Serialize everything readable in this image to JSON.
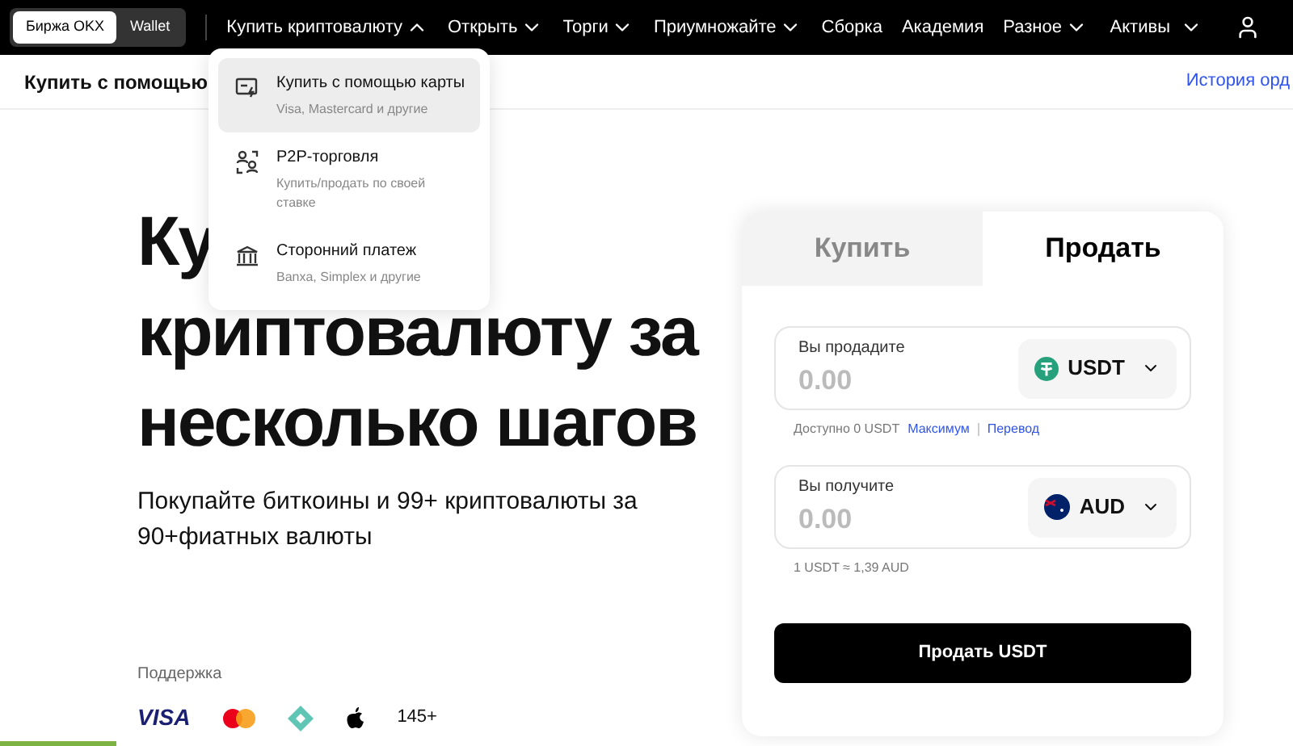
{
  "header": {
    "switch": [
      {
        "label": "Биржа OKX",
        "selected": true
      },
      {
        "label": "Wallet",
        "selected": false
      }
    ],
    "nav": [
      {
        "kind": "menu",
        "label": "Купить криптовалюту",
        "expanded": true
      },
      {
        "kind": "menu",
        "label": "Открыть",
        "expanded": false
      },
      {
        "kind": "menu",
        "label": "Торги",
        "expanded": false
      },
      {
        "kind": "menu",
        "label": "Приумножайте",
        "expanded": false
      },
      {
        "kind": "link",
        "label": "Сборка"
      },
      {
        "kind": "link",
        "label": "Академия"
      },
      {
        "kind": "menu",
        "label": "Разное",
        "expanded": false
      }
    ],
    "assets": "Активы"
  },
  "subbar": {
    "title": "Купить с помощью",
    "link": "История орд"
  },
  "dropdown": [
    {
      "kind": "card",
      "title": "Купить с помощью карты",
      "subtitle": "Visa, Mastercard и другие",
      "selected": true
    },
    {
      "kind": "p2p",
      "title": "P2P-торговля",
      "subtitle": "Купить/продать по своей ставке",
      "selected": false
    },
    {
      "kind": "bank",
      "title": "Сторонний платеж",
      "subtitle": "Banxa, Simplex и другие",
      "selected": false
    }
  ],
  "hero": {
    "heading": [
      "Ку",
      "криптовалюту за",
      "несколько шагов"
    ],
    "subtitle": "Покупайте биткоины и 99+ криптовалюты за 90+фиатных валюты"
  },
  "support": {
    "label": "Поддержка",
    "visa": "VISA",
    "count": "145+"
  },
  "trade": {
    "tabs": [
      {
        "label": "Купить",
        "selected": false
      },
      {
        "label": "Продать",
        "selected": true
      }
    ],
    "sell": {
      "label": "Вы продадите",
      "placeholder": "0.00",
      "currency": "USDT"
    },
    "available": "Доступно 0 USDT",
    "max": "Максимум",
    "transfer": "Перевод",
    "receive": {
      "label": "Вы получите",
      "placeholder": "0.00",
      "currency": "AUD"
    },
    "rate": "1 USDT ≈ 1,39 AUD",
    "button": "Продать USDT"
  }
}
